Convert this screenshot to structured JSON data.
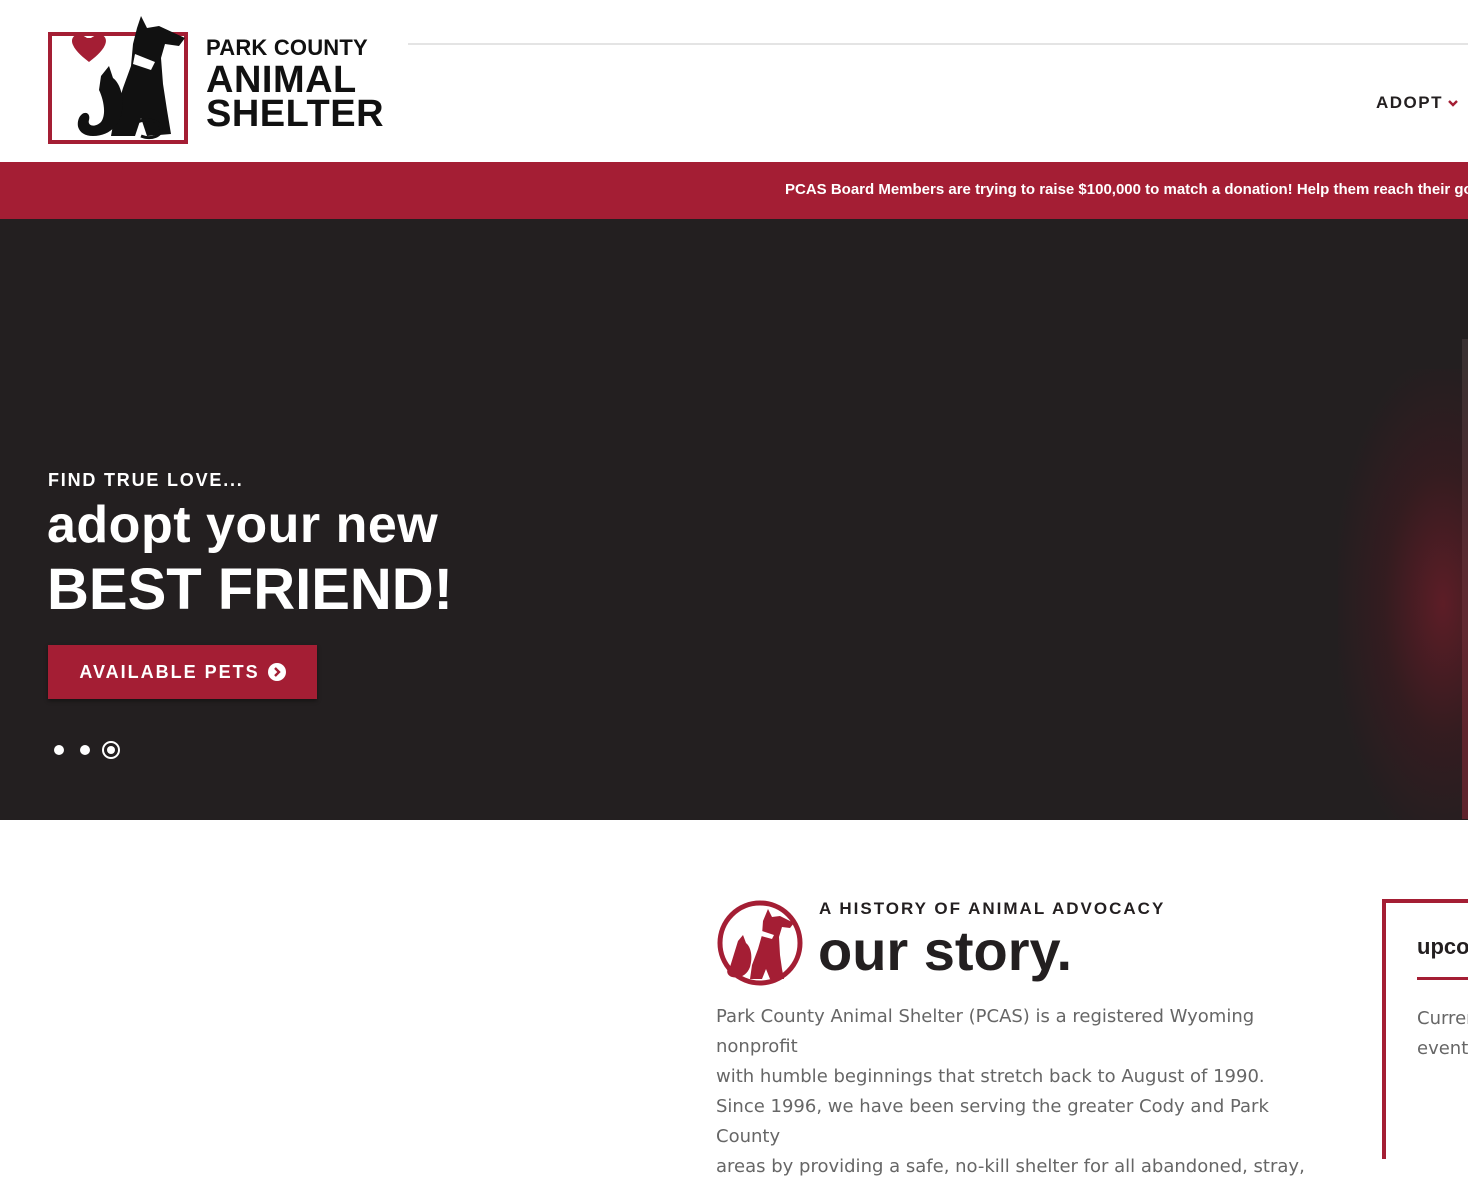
{
  "header": {
    "logo": {
      "line1": "PARK COUNTY",
      "line2": "ANIMAL",
      "line3": "SHELTER",
      "icon": "dog-and-cat-heart-logo"
    },
    "nav": {
      "adopt_label": "ADOPT",
      "adopt_icon": "chevron-down-icon"
    }
  },
  "banner": {
    "text": "PCAS Board Members are trying to raise $100,000 to match a donation! Help them reach their goal"
  },
  "hero": {
    "kicker": "FIND TRUE LOVE...",
    "line1": "adopt your new",
    "line2": "BEST FRIEND!",
    "button_label": "AVAILABLE PETS",
    "button_icon": "chevron-circle-right-icon",
    "slides_total": 3,
    "active_slide": 3
  },
  "story": {
    "icon": "dog-and-cat-circle-icon",
    "kicker": "A HISTORY OF ANIMAL ADVOCACY",
    "title": "our story.",
    "paragraph1_line1": "Park County Animal Shelter (PCAS) is a registered Wyoming nonprofit",
    "paragraph1_line2": "with humble beginnings that stretch back to August of 1990.",
    "paragraph2_line1": "Since 1996, we have been serving the greater Cody and Park County",
    "paragraph2_line2": "areas by providing a safe, no-kill shelter for all abandoned, stray,"
  },
  "events_card": {
    "title": "upco",
    "text_line1": "Curren",
    "text_line2": "events"
  },
  "colors": {
    "brand_red": "#a41e34",
    "dark": "#231f20",
    "body_text": "#666666"
  }
}
